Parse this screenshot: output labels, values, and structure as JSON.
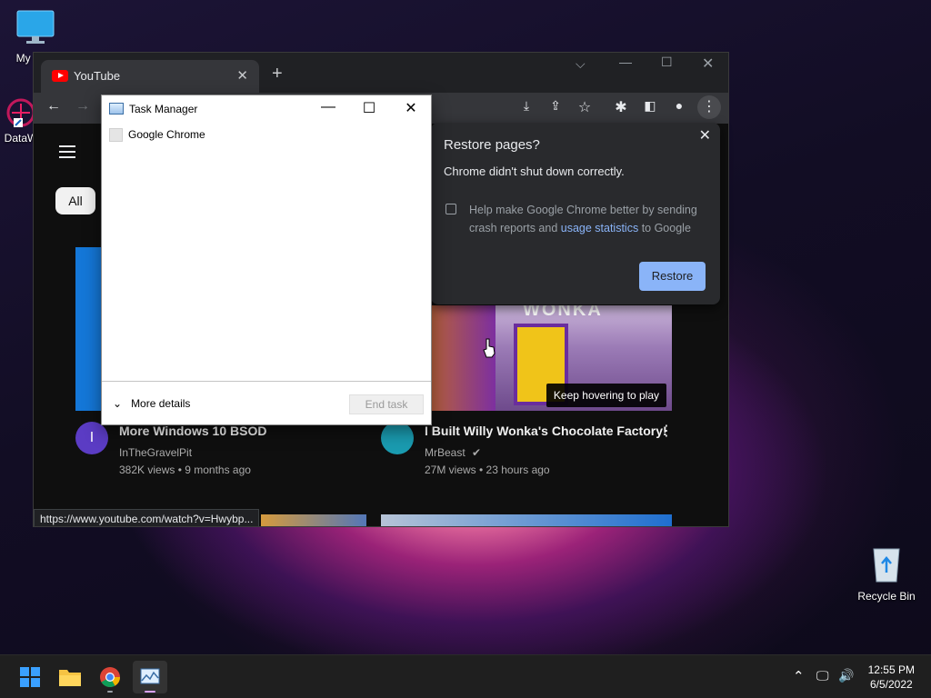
{
  "desktop": {
    "icons": [
      {
        "label": "My Co"
      },
      {
        "label": "DataW"
      },
      {
        "label": "Recycle Bin"
      }
    ]
  },
  "chrome": {
    "tab_title": "YouTube",
    "new_tab_symbol": "+",
    "status_url": "https://www.youtube.com/watch?v=Hwybp...",
    "chip_all": "All",
    "videos": [
      {
        "title": "More Windows 10 BSOD",
        "channel": "InTheGravelPit",
        "meta": "382K views • 9 months ago",
        "avatar_letter": "I",
        "avatar_color": "#5b3cc4"
      },
      {
        "title": "I Built Willy Wonka's Chocolate Factory!",
        "channel": "MrBeast",
        "meta": "27M views • 23 hours ago",
        "avatar_color": "#1a9bb0"
      }
    ],
    "hover_tooltip": "Keep hovering to play",
    "thumb_sign": "WONKA",
    "restore_popup": {
      "title": "Restore pages?",
      "subtitle": "Chrome didn't shut down correctly.",
      "help_text_1": "Help make Google Chrome better by sending crash reports and ",
      "help_link": "usage statistics",
      "help_text_2": " to Google",
      "restore_button": "Restore"
    }
  },
  "task_manager": {
    "title": "Task Manager",
    "process": "Google Chrome",
    "more_details": "More details",
    "end_task": "End task"
  },
  "taskbar": {
    "time": "12:55 PM",
    "date": "6/5/2022"
  },
  "colors": {
    "accent": "#8ab4f8",
    "chrome_bg": "#202124",
    "youtube_red": "#ff0000"
  }
}
